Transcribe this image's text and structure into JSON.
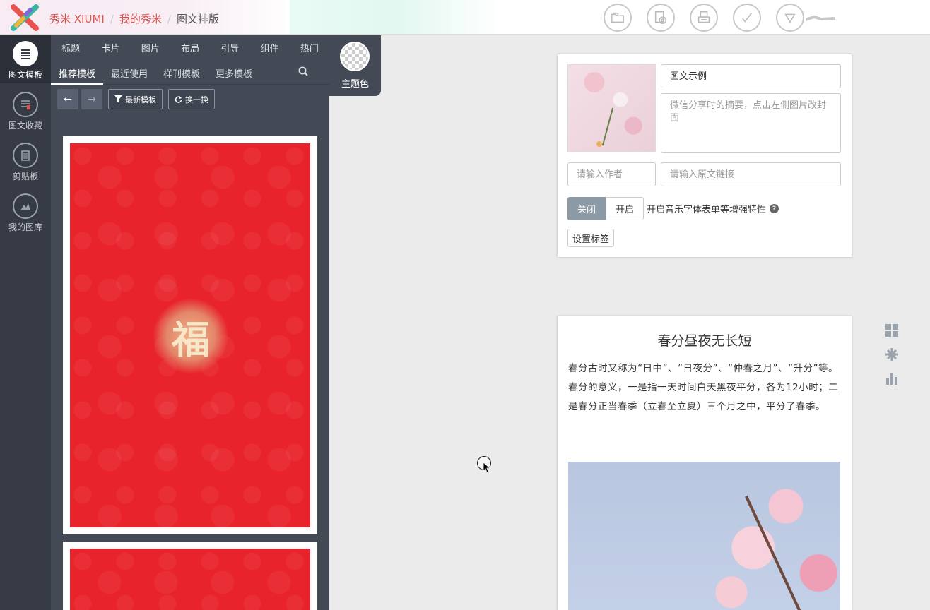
{
  "app": {
    "brand": "秀米 XIUMI",
    "breadcrumb": [
      "我的秀米",
      "图文排版"
    ]
  },
  "toolbar": {
    "icons": [
      "folder-icon",
      "image-settings-icon",
      "print-icon",
      "check-icon",
      "dropdown-triangle-icon"
    ]
  },
  "rail": {
    "items": [
      {
        "label": "图文模板",
        "icon": "list-icon"
      },
      {
        "label": "图文收藏",
        "icon": "bookmark-list-icon"
      },
      {
        "label": "剪贴板",
        "icon": "clipboard-icon"
      },
      {
        "label": "我的图库",
        "icon": "image-library-icon"
      }
    ]
  },
  "panel": {
    "categories": [
      "标题",
      "卡片",
      "图片",
      "布局",
      "引导",
      "组件",
      "热门"
    ],
    "tabs": [
      "推荐模板",
      "最近使用",
      "样刊模板",
      "更多模板"
    ],
    "active_tab": "推荐模板",
    "actions": {
      "newest": "最新模板",
      "shuffle": "换一换"
    },
    "theme_label": "主题色",
    "template_badge_text": "福"
  },
  "meta": {
    "title_value": "图文示例",
    "summary_placeholder": "微信分享时的摘要，点击左侧图片改封面",
    "author_placeholder": "请输入作者",
    "link_placeholder": "请输入原文链接",
    "toggle_off": "关闭",
    "toggle_on": "开启",
    "feature_text": "开启音乐字体表单等增强特性",
    "help_glyph": "?",
    "tag_button": "设置标签"
  },
  "article": {
    "title": "春分昼夜无长短",
    "body": "春分古时又称为“日中”、“日夜分”、“仲春之月”、“升分”等。春分的意义，一是指一天时间白天黑夜平分，各为12小时；二是春分正当春季（立春至立夏）三个月之中，平分了春季。"
  },
  "colors": {
    "accent_red": "#e8232b",
    "brand_red": "#d9534f",
    "panel_bg": "#434a55",
    "rail_bg": "#363b45"
  }
}
